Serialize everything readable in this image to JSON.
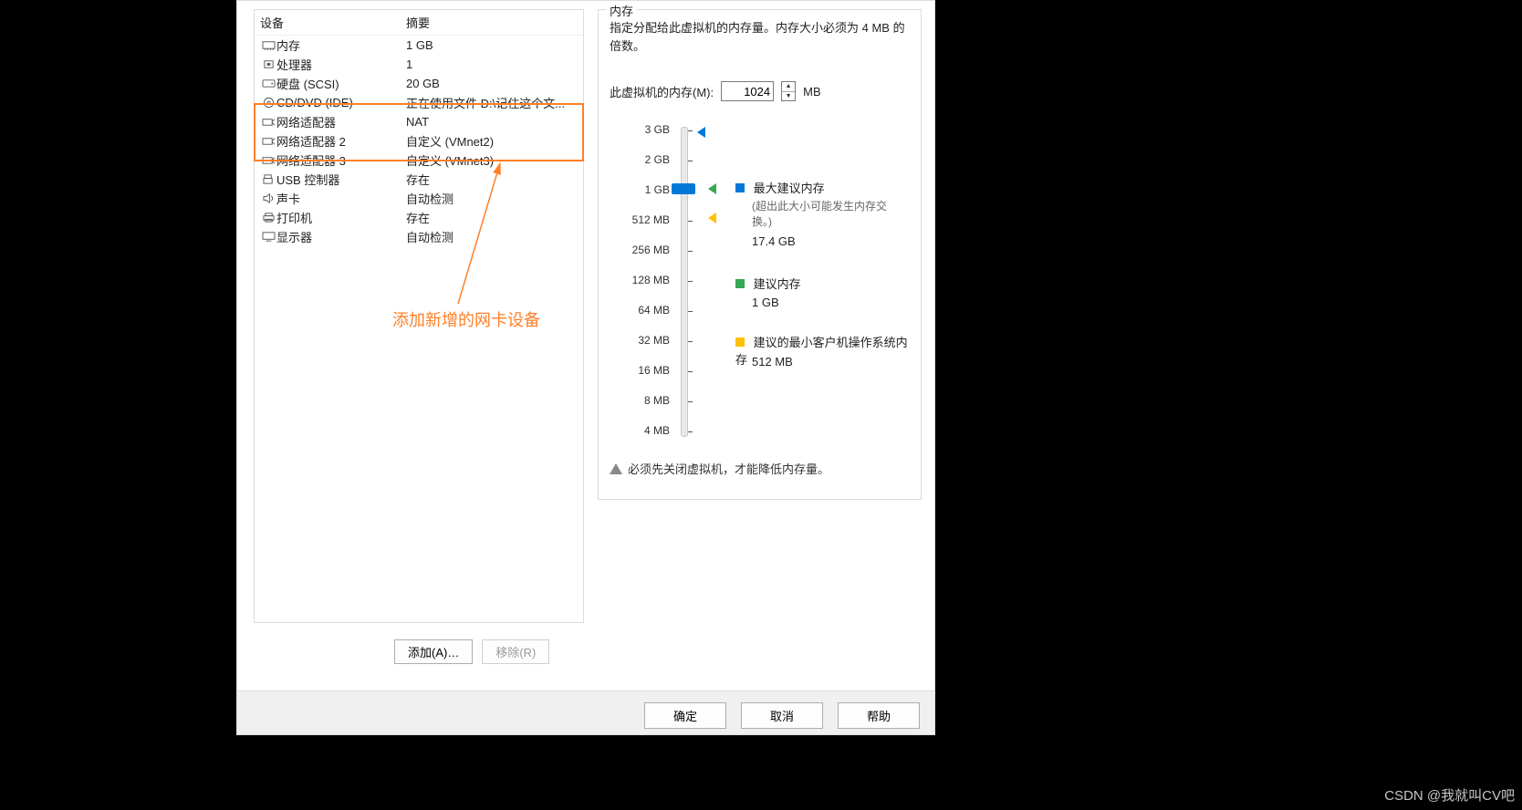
{
  "device_panel": {
    "head_device": "设备",
    "head_summary": "摘要",
    "rows": [
      {
        "icon": "memory-icon",
        "name": "内存",
        "value": "1 GB"
      },
      {
        "icon": "cpu-icon",
        "name": "处理器",
        "value": "1"
      },
      {
        "icon": "hdd-icon",
        "name": "硬盘 (SCSI)",
        "value": "20 GB"
      },
      {
        "icon": "cd-icon",
        "name": "CD/DVD (IDE)",
        "value": "正在使用文件 D:\\记住这个文..."
      },
      {
        "icon": "net-icon",
        "name": "网络适配器",
        "value": "NAT"
      },
      {
        "icon": "net-icon",
        "name": "网络适配器 2",
        "value": "自定义 (VMnet2)"
      },
      {
        "icon": "net-icon",
        "name": "网络适配器 3",
        "value": "自定义 (VMnet3)"
      },
      {
        "icon": "usb-icon",
        "name": "USB 控制器",
        "value": "存在"
      },
      {
        "icon": "sound-icon",
        "name": "声卡",
        "value": "自动检测"
      },
      {
        "icon": "printer-icon",
        "name": "打印机",
        "value": "存在"
      },
      {
        "icon": "display-icon",
        "name": "显示器",
        "value": "自动检测"
      }
    ],
    "add_btn": "添加(A)…",
    "remove_btn": "移除(R)"
  },
  "annotation": {
    "text": "添加新增的网卡设备"
  },
  "memory": {
    "legend": "内存",
    "desc": "指定分配给此虚拟机的内存量。内存大小必须为 4 MB 的倍数。",
    "label": "此虚拟机的内存(M):",
    "value": "1024",
    "unit": "MB",
    "ticks": [
      "3 GB",
      "2 GB",
      "1 GB",
      "512 MB",
      "256 MB",
      "128 MB",
      "64 MB",
      "32 MB",
      "16 MB",
      "8 MB",
      "4 MB"
    ],
    "max_label": "最大建议内存",
    "max_sub1": "(超出此大小可能发生内存交换。)",
    "max_sub2": "17.4 GB",
    "rec_label": "建议内存",
    "rec_val": "1 GB",
    "min_label": "建议的最小客户机操作系统内存",
    "min_val": "512 MB",
    "warn": "必须先关闭虚拟机，才能降低内存量。"
  },
  "bottom": {
    "ok": "确定",
    "cancel": "取消",
    "help": "帮助"
  },
  "watermark": "CSDN @我就叫CV吧"
}
